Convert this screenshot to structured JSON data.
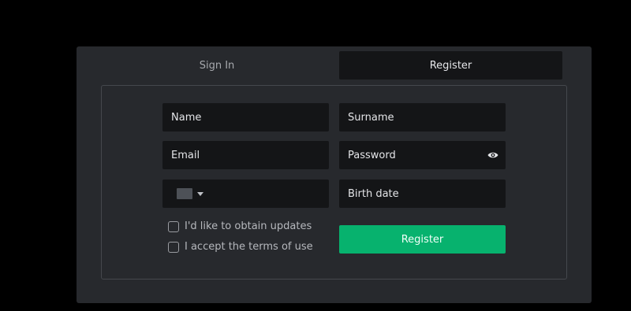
{
  "tabs": {
    "signin_label": "Sign In",
    "register_label": "Register"
  },
  "form": {
    "name_placeholder": "Name",
    "surname_placeholder": "Surname",
    "email_placeholder": "Email",
    "password_placeholder": "Password",
    "birthdate_placeholder": "Birth date",
    "updates_label": "I'd like to obtain updates",
    "terms_label": "I accept the terms of use",
    "submit_label": "Register"
  },
  "icons": {
    "password_toggle": "eye-icon",
    "country_dropdown": "chevron-down-icon"
  },
  "colors": {
    "accent": "#07b26e",
    "modal_bg": "#27292d",
    "field_bg": "#141517"
  }
}
